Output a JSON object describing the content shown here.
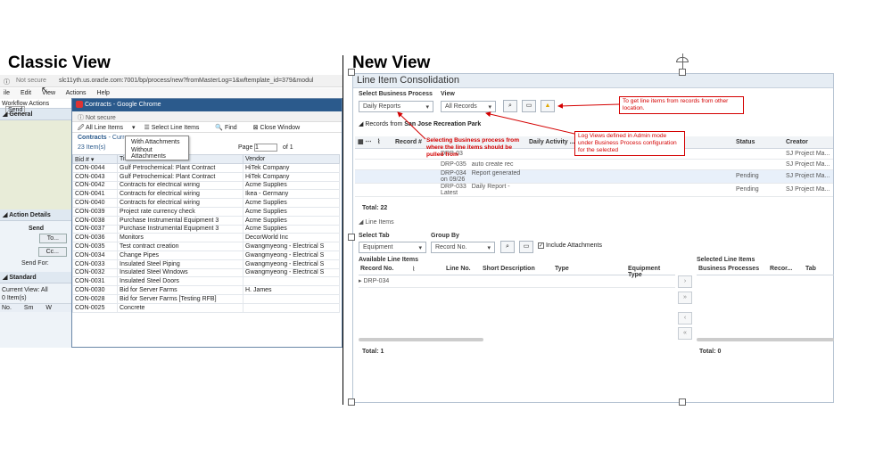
{
  "headings": {
    "classic": "Classic View",
    "new": "New View"
  },
  "classic": {
    "address": {
      "security": "Not secure",
      "url": "slc11yth.us.oracle.com:7001/bp/process/new?fromMasterLog=1&wftemplate_id=379&modul"
    },
    "menu": [
      "ile",
      "Edit",
      "View",
      "Actions",
      "Help"
    ],
    "left_panel": {
      "tabs": [
        "Workflow Actions",
        "Send"
      ],
      "general": "General",
      "action_details": "Action Details",
      "send": "Send",
      "to_button": "To...",
      "cc_button": "Cc...",
      "send_for": "Send For:",
      "standard": "Standard",
      "current_view_label": "Current View:",
      "current_view_value": "All",
      "items": "0  Item(s)",
      "cols": [
        "No.",
        "Sm",
        "W"
      ]
    },
    "popup": {
      "title": "Contracts - Google Chrome",
      "security": "Not secure",
      "tools": [
        "All Line Items",
        "Select Line Items",
        "Find",
        "Close Window"
      ],
      "dropdown": [
        "With Attachments",
        "Without Attachments"
      ],
      "breadcrumb": "Contracts",
      "breadcrumb_suffix": "- Curren",
      "breadcrumb_tail": "s",
      "items": "23  Item(s)",
      "page_label": "Page",
      "page_value": "1",
      "page_of": "of  1",
      "columns": [
        "Bid #",
        "Title",
        "Vendor"
      ],
      "rows": [
        [
          "CON-0044",
          "Gulf Petrochemical: Plant Contract",
          "HiTek Company"
        ],
        [
          "CON-0043",
          "Gulf Petrochemical: Plant Contract",
          "HiTek Company"
        ],
        [
          "CON-0042",
          "Contracts for electrical wiring",
          "Acme Supplies"
        ],
        [
          "CON-0041",
          "Contracts for electrical wiring",
          "Ikea - Germany"
        ],
        [
          "CON-0040",
          "Contracts for electrical wiring",
          "Acme Supplies"
        ],
        [
          "CON-0039",
          "Project rate currency check",
          "Acme Supplies"
        ],
        [
          "CON-0038",
          "Purchase Instrumental Equipment 3",
          "Acme Supplies"
        ],
        [
          "CON-0037",
          "Purchase Instrumental Equipment 3",
          "Acme Supplies"
        ],
        [
          "CON-0036",
          "Monitors",
          "DecorWorld Inc"
        ],
        [
          "CON-0035",
          "Test contract creation",
          "Gwangmyeong - Electrical S"
        ],
        [
          "CON-0034",
          "Change Pipes",
          "Gwangmyeong - Electrical S"
        ],
        [
          "CON-0033",
          "Insulated Steel Piping",
          "Gwangmyeong - Electrical S"
        ],
        [
          "CON-0032",
          "Insulated Steel Windows",
          "Gwangmyeong - Electrical S"
        ],
        [
          "CON-0031",
          "Insulated Steel Doors",
          ""
        ],
        [
          "CON-0030",
          "Bid for Server Farms",
          "H. James"
        ],
        [
          "CON-0028",
          "Bid for Server Farms [Testing RFB]",
          ""
        ],
        [
          "CON-0025",
          "Concrete",
          ""
        ]
      ]
    }
  },
  "new": {
    "title": "Line Item Consolidation",
    "select_bp_label": "Select Business Process",
    "select_bp_value": "Daily Reports",
    "view_label": "View",
    "view_value": "All Records",
    "records_from_label": "Records from",
    "records_from_value": "San Jose Recreation Park",
    "records_columns": [
      "Record #",
      "Daily Activity ...",
      "Status",
      "Creator"
    ],
    "records_rows": [
      [
        "DRP-03",
        "",
        "",
        "SJ Project Ma..."
      ],
      [
        "DRP-035",
        "auto create rec",
        "",
        "SJ Project Ma..."
      ],
      [
        "DRP-034",
        "Report generated on 09/26",
        "Pending",
        "SJ Project Ma..."
      ],
      [
        "DRP-033",
        "Daily Report -Latest",
        "Pending",
        "SJ Project Ma..."
      ]
    ],
    "total_records": "Total: 22",
    "line_items_header": "Line Items",
    "select_tab_label": "Select Tab",
    "select_tab_value": "Equipment",
    "group_by_label": "Group By",
    "group_by_value": "Record No.",
    "include_attachments": "Include Attachments",
    "available_label": "Available Line Items",
    "available_columns": [
      "Record No.",
      "Line No.",
      "Short Description",
      "Type",
      "Equipment Type"
    ],
    "available_rows": [
      "DRP-034"
    ],
    "selected_label": "Selected Line Items",
    "selected_columns": [
      "Business Processes",
      "Recor...",
      "Tab"
    ],
    "total_available": "Total: 1",
    "total_selected": "Total: 0",
    "annotations": {
      "other_location": "To get line items from records from other location.",
      "bp_selection": "Selecting Business process from where the line items should be pulled from",
      "log_views": "Log Views defined in Admin mode under Business Process configuration for the selected"
    }
  },
  "colors": {
    "annotation": "#d40000",
    "chrome_title": "#2b5a8c"
  }
}
